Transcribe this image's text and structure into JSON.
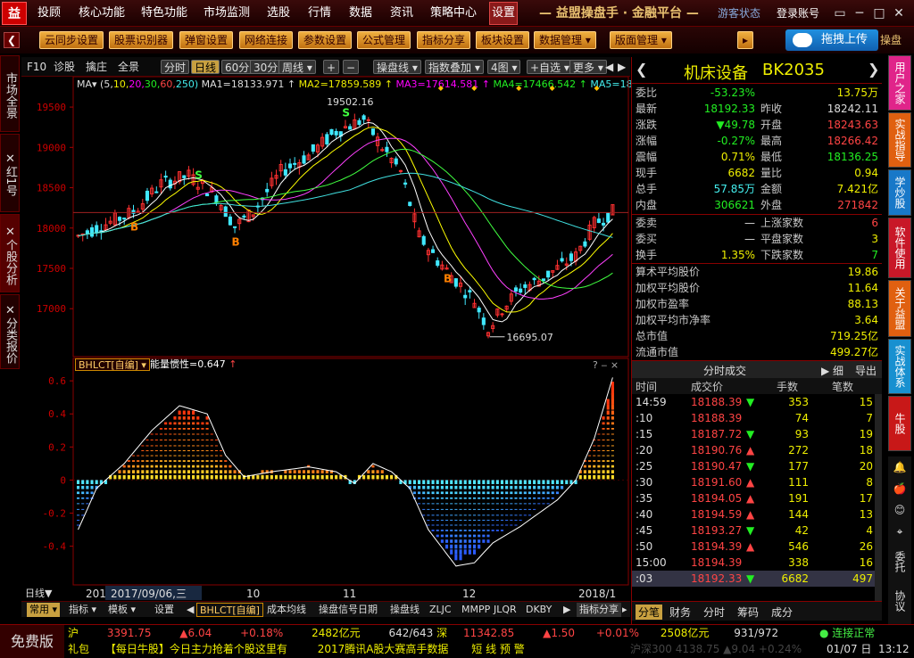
{
  "menu": {
    "logo": "益",
    "items": [
      "投顾",
      "核心功能",
      "特色功能",
      "市场监测",
      "选股",
      "行情",
      "数据",
      "资讯",
      "策略中心",
      "设置"
    ],
    "title": "— 益盟操盘手 · 金融平台 —",
    "guest": "游客状态",
    "login": "登录账号",
    "controls": [
      "▭",
      "─",
      "□",
      "✕"
    ]
  },
  "toolbar": {
    "buttons": [
      "云同步设置",
      "股票识别器",
      "弹窗设置",
      "网络连接",
      "参数设置",
      "公式管理",
      "指标分享",
      "板块设置",
      "数据管理 ▾",
      "版面管理 ▾"
    ],
    "more": "▸",
    "upload": "拖拽上传",
    "opdisk": "操盘"
  },
  "left_tabs": [
    "市场全景",
    "红1号",
    "个股分析",
    "分类报价"
  ],
  "left_tab_close": "✕",
  "chart_header": {
    "items": [
      "F10",
      "诊股",
      "擒庄",
      "全景"
    ],
    "periods": [
      "分时",
      "日线",
      "60分",
      "30分",
      "周线 ▾"
    ],
    "zoom": [
      "+",
      "−"
    ],
    "tools": [
      "操盘线 ▾",
      "指数叠加 ▾",
      "4图 ▾",
      "+自选 ▾",
      "更多 ▾"
    ],
    "arrows": [
      "◀",
      "▶"
    ]
  },
  "ma_line": {
    "prefix": "MA",
    "dropdown": "▾",
    "params_open": "(5,",
    "params": [
      "10,",
      "20,",
      "30,",
      "60,",
      "250)"
    ],
    "values": [
      "MA1=18133.971 ↑",
      "MA2=17859.589 ↑",
      "MA3=17614.581 ↑",
      "MA4=17466.542 ↑",
      "MA5=18"
    ]
  },
  "chart_data": [
    {
      "type": "candlestick",
      "title": "",
      "y_ticks": [
        19500,
        19000,
        18500,
        18000,
        17500,
        17000
      ],
      "ylim": [
        16560,
        19700
      ],
      "annotations": [
        {
          "label": "19502.16",
          "kind": "high"
        },
        {
          "label": "16695.07",
          "kind": "low"
        }
      ],
      "signals": [
        {
          "label": "B",
          "index": 12
        },
        {
          "label": "S",
          "index": 26
        },
        {
          "label": "B",
          "index": 34
        },
        {
          "label": "S",
          "index": 58
        },
        {
          "label": "B",
          "index": 80
        }
      ],
      "x_ticks": [
        "2017",
        "2017/09/06,三",
        "10",
        "11",
        "12",
        "2018/1"
      ]
    },
    {
      "type": "bar",
      "title": "能量惯性=0.647",
      "indicator": "BHLCT[自编]",
      "y_ticks": [
        0.6,
        0.4,
        0.2,
        0.0,
        -0.2,
        -0.4
      ],
      "ylim": [
        -0.58,
        0.66
      ]
    }
  ],
  "chart_controls": {
    "top": [
      "?",
      "‒",
      "⨯"
    ],
    "ind": [
      "?",
      "–",
      "⨯"
    ],
    "title_arrow": "↑"
  },
  "bottom_axis": {
    "label": "日线",
    "arrow": "▼"
  },
  "bottom_tabs": {
    "left": [
      "常用 ▾",
      "指标 ▾",
      "模板 ▾",
      "设置"
    ],
    "tabs": [
      "BHLCT[自编]",
      "成本均线",
      "操盘信号日期",
      "操盘线",
      "ZLJC",
      "MMPP",
      "JLQR",
      "DKBY"
    ],
    "arrows": [
      "◀",
      "▶"
    ],
    "share": "指标分享",
    "more": "▸"
  },
  "quote": {
    "name": "机床设备",
    "code": "BK2035",
    "nav": [
      "❮",
      "❯"
    ],
    "rows": [
      {
        "l1": "委比",
        "v1": "-53.23%",
        "c1": "grn",
        "l2": "",
        "v2": "13.75万",
        "c2": "yel"
      },
      {
        "l1": "最新",
        "v1": "18192.33",
        "c1": "grn",
        "l2": "昨收",
        "v2": "18242.11",
        "c2": "wht"
      },
      {
        "l1": "涨跌",
        "v1": "▼49.78",
        "c1": "grn",
        "l2": "开盘",
        "v2": "18243.63",
        "c2": "red"
      },
      {
        "l1": "涨幅",
        "v1": "-0.27%",
        "c1": "grn",
        "l2": "最高",
        "v2": "18266.42",
        "c2": "red"
      },
      {
        "l1": "震幅",
        "v1": "0.71%",
        "c1": "yel",
        "l2": "最低",
        "v2": "18136.25",
        "c2": "grn"
      },
      {
        "l1": "现手",
        "v1": "6682",
        "c1": "yel",
        "l2": "量比",
        "v2": "0.94",
        "c2": "yel"
      },
      {
        "l1": "总手",
        "v1": "57.85万",
        "c1": "cyn",
        "l2": "金额",
        "v2": "7.421亿",
        "c2": "yel"
      },
      {
        "l1": "内盘",
        "v1": "306621",
        "c1": "grn",
        "l2": "外盘",
        "v2": "271842",
        "c2": "red"
      }
    ],
    "rows2": [
      {
        "l1": "委卖",
        "v1": "—",
        "c1": "wht",
        "l2": "上涨家数",
        "v2": "6",
        "c2": "red"
      },
      {
        "l1": "委买",
        "v1": "—",
        "c1": "wht",
        "l2": "平盘家数",
        "v2": "3",
        "c2": "yel"
      },
      {
        "l1": "换手",
        "v1": "1.35%",
        "c1": "yel",
        "l2": "下跌家数",
        "v2": "7",
        "c2": "grn"
      }
    ],
    "rows3": [
      {
        "l": "算术平均股价",
        "v": "19.86"
      },
      {
        "l": "加权平均股价",
        "v": "11.64"
      },
      {
        "l": "加权市盈率",
        "v": "88.13"
      },
      {
        "l": "加权平均市净率",
        "v": "3.64"
      },
      {
        "l": "总市值",
        "v": "719.25亿"
      },
      {
        "l": "流通市值",
        "v": "499.27亿"
      }
    ]
  },
  "ticks": {
    "title": "分时成交",
    "detail": "▶ 细",
    "export": "导出",
    "headers": [
      "时间",
      "成交价",
      "手数",
      "笔数"
    ],
    "rows": [
      {
        "t": "14:59",
        "p": "18188.39",
        "d": "▼",
        "v": "353",
        "n": "15"
      },
      {
        "t": ":10",
        "p": "18188.39",
        "d": "",
        "v": "74",
        "n": "7"
      },
      {
        "t": ":15",
        "p": "18187.72",
        "d": "▼",
        "v": "93",
        "n": "19"
      },
      {
        "t": ":20",
        "p": "18190.76",
        "d": "▲",
        "v": "272",
        "n": "18"
      },
      {
        "t": ":25",
        "p": "18190.47",
        "d": "▼",
        "v": "177",
        "n": "20"
      },
      {
        "t": ":30",
        "p": "18191.60",
        "d": "▲",
        "v": "111",
        "n": "8"
      },
      {
        "t": ":35",
        "p": "18194.05",
        "d": "▲",
        "v": "191",
        "n": "17"
      },
      {
        "t": ":40",
        "p": "18194.59",
        "d": "▲",
        "v": "144",
        "n": "13"
      },
      {
        "t": ":45",
        "p": "18193.27",
        "d": "▼",
        "v": "42",
        "n": "4"
      },
      {
        "t": ":50",
        "p": "18194.39",
        "d": "▲",
        "v": "546",
        "n": "26"
      },
      {
        "t": "15:00",
        "p": "18194.39",
        "d": "",
        "v": "338",
        "n": "16"
      },
      {
        "t": ":03",
        "p": "18192.33",
        "d": "▼",
        "v": "6682",
        "n": "497"
      }
    ],
    "bottom_tabs": [
      "分笔",
      "财务",
      "分时",
      "筹码",
      "成分"
    ]
  },
  "right_tabs": [
    "用户之家",
    "实战指导",
    "学炒股",
    "软件使用",
    "关于益盟",
    "实战体系",
    "牛股"
  ],
  "right_icons": [
    "🔔",
    "🍎",
    "😊",
    "⌖",
    "委托",
    "协议"
  ],
  "status": {
    "free": "免费版",
    "sh_label": "沪",
    "sh_index": "3391.75",
    "sh_chg": "▲6.04",
    "sh_pct": "+0.18%",
    "sh_amt": "2482亿元",
    "sh_updown": "642/643",
    "sz_label": "深",
    "sz_index": "11342.85",
    "sz_chg": "▲1.50",
    "sz_pct": "+0.01%",
    "sz_amt": "2508亿元",
    "sz_updown": "931/972",
    "conn": "连接正常",
    "news1": "礼包",
    "news2": "【每日牛股】今日主力抢着个股这里有",
    "news3": "2017腾讯A股大赛高手数据",
    "news4": "短 线 预 警",
    "sz300": "沪深300 4138.75 ▲9.04 +0.24%",
    "date": "01/07 日",
    "time": "13:12"
  }
}
